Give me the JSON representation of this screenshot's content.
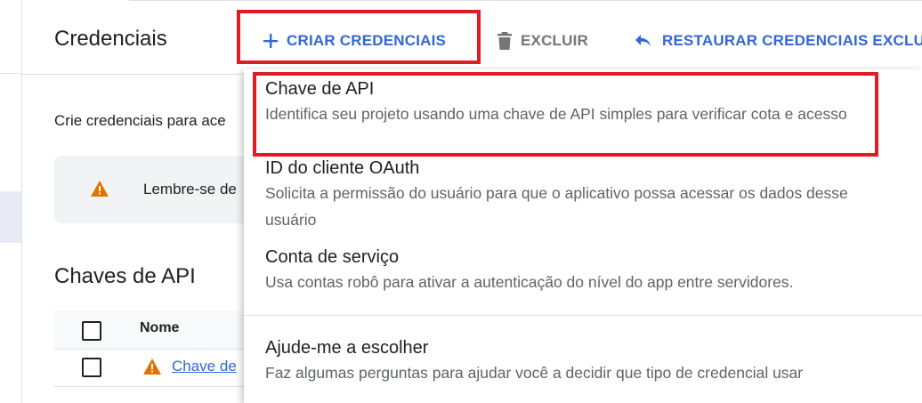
{
  "header": {
    "title": "Credenciais",
    "create_label": "CRIAR CREDENCIAIS",
    "delete_label": "EXCLUIR",
    "restore_label": "RESTAURAR CREDENCIAIS EXCLU"
  },
  "main": {
    "intro": "Crie credenciais para ace",
    "warning_text": "Lembre-se de",
    "section_title": "Chaves de API",
    "table": {
      "columns": [
        "Nome"
      ],
      "rows": [
        {
          "name": "Chave de"
        }
      ]
    }
  },
  "menu": {
    "items": [
      {
        "title": "Chave de API",
        "description": "Identifica seu projeto usando uma chave de API simples para verificar cota e acesso"
      },
      {
        "title": "ID do cliente OAuth",
        "description": "Solicita a permissão do usuário para que o aplicativo possa acessar os dados desse usuário"
      },
      {
        "title": "Conta de serviço",
        "description": "Usa contas robô para ativar a autenticação do nível do app entre servidores."
      },
      {
        "title": "Ajude-me a escolher",
        "description": "Faz algumas perguntas para ajudar você a decidir que tipo de credencial usar"
      }
    ]
  },
  "colors": {
    "accent": "#3367d6",
    "highlight": "#e01b24",
    "warning": "#e37400",
    "muted": "#757575"
  },
  "icons": {
    "create": "plus-icon",
    "delete": "trash-icon",
    "restore": "undo-icon",
    "warning": "warning-icon"
  }
}
